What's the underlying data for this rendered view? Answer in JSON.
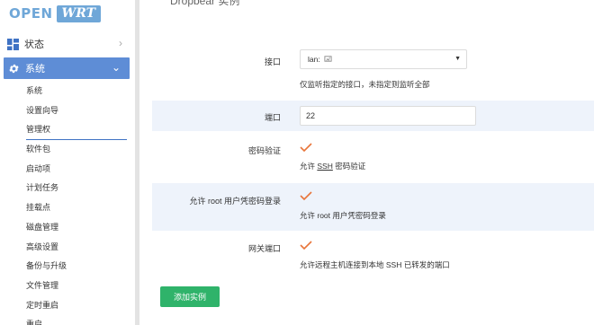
{
  "brand": {
    "name_left": "OPEN",
    "name_right": "WRT"
  },
  "header": {
    "title": "Dropbear 实例"
  },
  "sidebar": {
    "status_label": "状态",
    "system_label": "系统",
    "items": [
      {
        "label": "系统"
      },
      {
        "label": "设置向导"
      },
      {
        "label": "管理权"
      },
      {
        "label": "软件包"
      },
      {
        "label": "启动项"
      },
      {
        "label": "计划任务"
      },
      {
        "label": "挂载点"
      },
      {
        "label": "磁盘管理"
      },
      {
        "label": "高级设置"
      },
      {
        "label": "备份与升级"
      },
      {
        "label": "文件管理"
      },
      {
        "label": "定时重启"
      },
      {
        "label": "重启"
      }
    ],
    "active_item": "管理权"
  },
  "form": {
    "interface": {
      "label": "接口",
      "value": "lan:",
      "help": "仅监听指定的接口，未指定则监听全部"
    },
    "port": {
      "label": "端口",
      "value": "22"
    },
    "password_auth": {
      "label": "密码验证",
      "checked": true,
      "help_prefix": "允许 ",
      "help_abbr": "SSH",
      "help_suffix": " 密码验证"
    },
    "root_password": {
      "label": "允许 root 用户凭密码登录",
      "checked": true,
      "help": "允许 root 用户凭密码登录"
    },
    "gateway_ports": {
      "label": "网关端口",
      "checked": true,
      "help": "允许远程主机连接到本地 SSH 已转发的端口"
    }
  },
  "buttons": {
    "add_instance": "添加实例"
  },
  "colors": {
    "accent": "#5e8dd6",
    "logo": "#6fa7d8",
    "check": "#e8753a",
    "button": "#2fb36a",
    "row_shade": "#eef3fb"
  }
}
